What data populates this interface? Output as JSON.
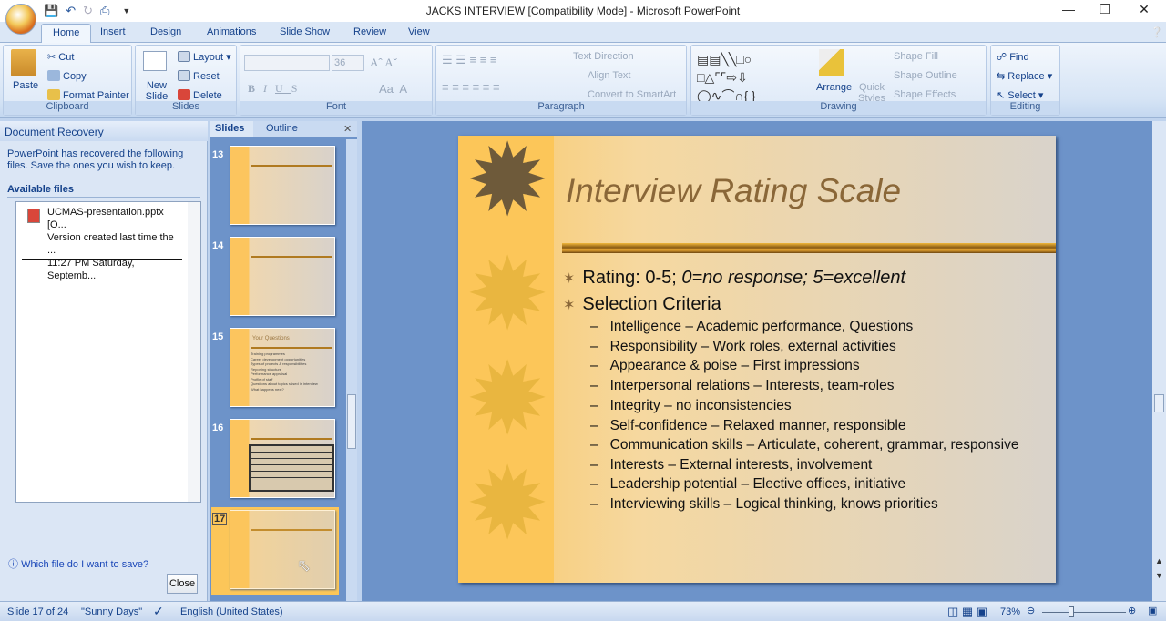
{
  "window": {
    "title": "JACKS INTERVIEW [Compatibility Mode] - Microsoft PowerPoint"
  },
  "tabs": [
    "Home",
    "Insert",
    "Design",
    "Animations",
    "Slide Show",
    "Review",
    "View"
  ],
  "ribbon": {
    "clipboard": {
      "label": "Clipboard",
      "paste": "Paste",
      "cut": "Cut",
      "copy": "Copy",
      "format_painter": "Format Painter"
    },
    "slides": {
      "label": "Slides",
      "new_slide": "New Slide",
      "layout": "Layout",
      "reset": "Reset",
      "delete": "Delete"
    },
    "font": {
      "label": "Font",
      "font_name": "",
      "font_size": "36"
    },
    "paragraph": {
      "label": "Paragraph",
      "text_direction": "Text Direction",
      "align_text": "Align Text",
      "convert_smartart": "Convert to SmartArt"
    },
    "drawing": {
      "label": "Drawing",
      "arrange": "Arrange",
      "quick_styles": "Quick Styles",
      "shape_fill": "Shape Fill",
      "shape_outline": "Shape Outline",
      "shape_effects": "Shape Effects"
    },
    "editing": {
      "label": "Editing",
      "find": "Find",
      "replace": "Replace",
      "select": "Select"
    }
  },
  "recovery": {
    "title": "Document Recovery",
    "message": "PowerPoint has recovered the following files. Save the ones you wish to keep.",
    "available_files": "Available files",
    "file": {
      "name": "UCMAS-presentation.pptx  [O...",
      "desc": "Version created last time the ...",
      "time": "11:27 PM Saturday, Septemb..."
    },
    "help_link": "Which file do I want to save?",
    "close": "Close"
  },
  "slides_pane": {
    "tabs": [
      "Slides",
      "Outline"
    ],
    "thumbs": [
      {
        "num": "13",
        "title": "",
        "bullets": []
      },
      {
        "num": "14",
        "title": "",
        "bullets": []
      },
      {
        "num": "15",
        "title": "Your Questions",
        "bullets": [
          "Training programmes",
          "Career development opportunities",
          "Types of projects & responsibilities",
          "Reporting structure",
          "Performance appraisal",
          "Profile of staff",
          "Questions about topics raised in interview",
          "What happens next?"
        ]
      },
      {
        "num": "16",
        "title": "",
        "bullets": []
      },
      {
        "num": "17",
        "title": "",
        "bullets": []
      }
    ],
    "selected": "17"
  },
  "slide": {
    "title": "Interview Rating Scale",
    "bullet1_normal": "Rating: 0-5; ",
    "bullet1_italic": "0=no response; 5=excellent",
    "bullet2": "Selection Criteria",
    "sub": [
      "Intelligence – Academic performance, Questions",
      "Responsibility – Work roles, external activities",
      "Appearance & poise – First impressions",
      "Interpersonal relations – Interests, team-roles",
      "Integrity – no inconsistencies",
      "Self-confidence – Relaxed manner, responsible",
      "Communication skills – Articulate, coherent, grammar, responsive",
      "Interests – External interests, involvement",
      "Leadership potential – Elective offices, initiative",
      "Interviewing skills – Logical thinking, knows priorities"
    ]
  },
  "status": {
    "slide": "Slide 17 of 24",
    "theme": "\"Sunny Days\"",
    "language": "English (United States)",
    "zoom": "73%",
    "zoom_percent": 73
  }
}
